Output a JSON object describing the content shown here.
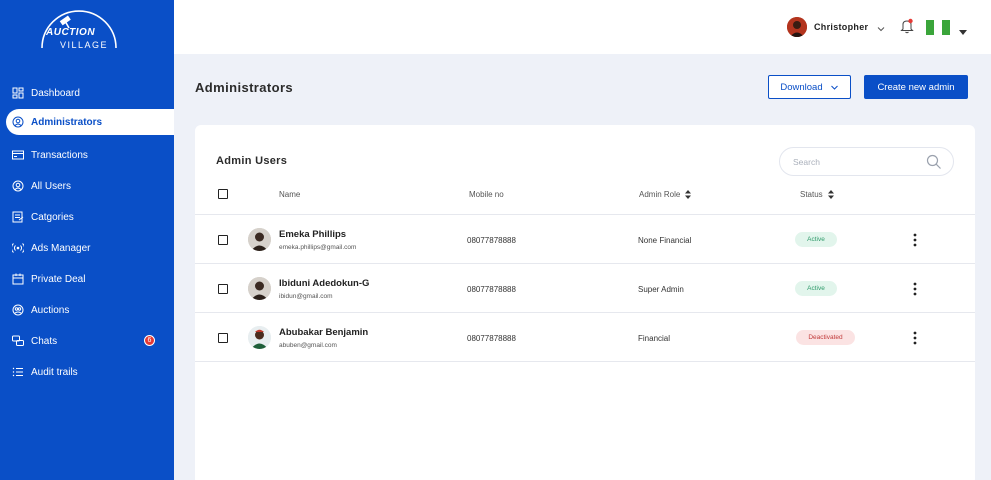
{
  "brand": {
    "line1": "AUCTION",
    "line2": "VILLAGE",
    "primary_color": "#0a4fc7"
  },
  "sidebar": {
    "items": [
      {
        "label": "Dashboard",
        "icon": "dashboard-icon"
      },
      {
        "label": "Administrators",
        "icon": "user-circle-icon",
        "active": true
      },
      {
        "label": "Transactions",
        "icon": "card-icon"
      },
      {
        "label": "All Users",
        "icon": "user-icon"
      },
      {
        "label": "Catgories",
        "icon": "category-icon"
      },
      {
        "label": "Ads Manager",
        "icon": "broadcast-icon"
      },
      {
        "label": "Private Deal",
        "icon": "calendar-icon"
      },
      {
        "label": "Auctions",
        "icon": "auction-icon"
      },
      {
        "label": "Chats",
        "icon": "chat-icon",
        "badge": "6"
      },
      {
        "label": "Audit trails",
        "icon": "list-icon"
      }
    ]
  },
  "topbar": {
    "username": "Christopher",
    "flag_colors": [
      "#3aa53a",
      "#ffffff",
      "#3aa53a"
    ]
  },
  "header": {
    "title": "Administrators",
    "download_label": "Download",
    "create_label": "Create new admin"
  },
  "table": {
    "title": "Admin Users",
    "search_placeholder": "Search",
    "columns": {
      "name": "Name",
      "mobile": "Mobile no",
      "role": "Admin Role",
      "status": "Status"
    },
    "rows": [
      {
        "name": "Emeka Phillips",
        "email": "emeka.phillips@gmail.com",
        "mobile": "08077878888",
        "role": "None Financial",
        "status": "Active"
      },
      {
        "name": "Ibiduni Adedokun-G",
        "email": "ibidun@gmail.com",
        "mobile": "08077878888",
        "role": "Super Admin",
        "status": "Active"
      },
      {
        "name": "Abubakar Benjamin",
        "email": "abuben@gmail.com",
        "mobile": "08077878888",
        "role": "Financial",
        "status": "Deactivated"
      }
    ]
  }
}
